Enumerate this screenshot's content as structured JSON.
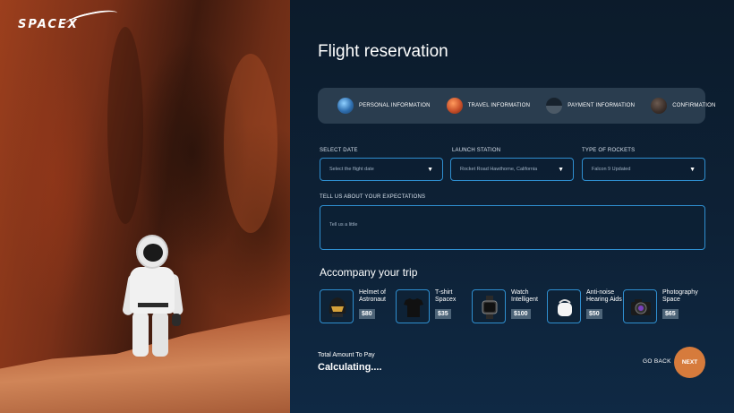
{
  "brand": {
    "logo": "SPACEX"
  },
  "form": {
    "title": "Flight reservation",
    "steps": [
      {
        "label": "PERSONAL INFORMATION",
        "icon": "earth-icon",
        "color": "#3b7fc4"
      },
      {
        "label": "TRAVEL INFORMATION",
        "icon": "mars-icon",
        "color": "#c8502a"
      },
      {
        "label": "PAYMENT INFORMATION",
        "icon": "planet-icon",
        "color": "#3e4a55"
      },
      {
        "label": "CONFIRMATION",
        "icon": "planet-icon",
        "color": "#4a3e38"
      }
    ],
    "fields": {
      "date": {
        "label": "SELECT DATE",
        "value": "Select the flight date"
      },
      "station": {
        "label": "LAUNCH STATION",
        "value": "Rocket Road Hawthorne, California"
      },
      "rocket": {
        "label": "TYPE OF ROCKETS",
        "value": "Falcon 9 Updated"
      },
      "expectations": {
        "label": "TELL US ABOUT YOUR EXPECTATIONS",
        "placeholder": "Tell us a little"
      }
    },
    "accessories_title": "Accompany your trip",
    "accessories": [
      {
        "name_line1": "Helmet of",
        "name_line2": "Astronaut",
        "price": "$80",
        "icon": "helmet-icon"
      },
      {
        "name_line1": "T-shirt",
        "name_line2": "Spacex",
        "price": "$35",
        "icon": "tshirt-icon"
      },
      {
        "name_line1": "Watch",
        "name_line2": "Intelligent",
        "price": "$100",
        "icon": "watch-icon"
      },
      {
        "name_line1": "Anti-noise",
        "name_line2": "Hearing Aids",
        "price": "$50",
        "icon": "earbuds-icon"
      },
      {
        "name_line1": "Photography",
        "name_line2": "Space",
        "price": "$65",
        "icon": "camera-icon"
      }
    ],
    "total_label": "Total Amount To Pay",
    "total_value": "Calculating....",
    "go_back": "GO BACK",
    "next": "NEXT"
  },
  "colors": {
    "accent": "#d67b3c",
    "border": "#2f8fd0",
    "panel": "#0d2136"
  }
}
